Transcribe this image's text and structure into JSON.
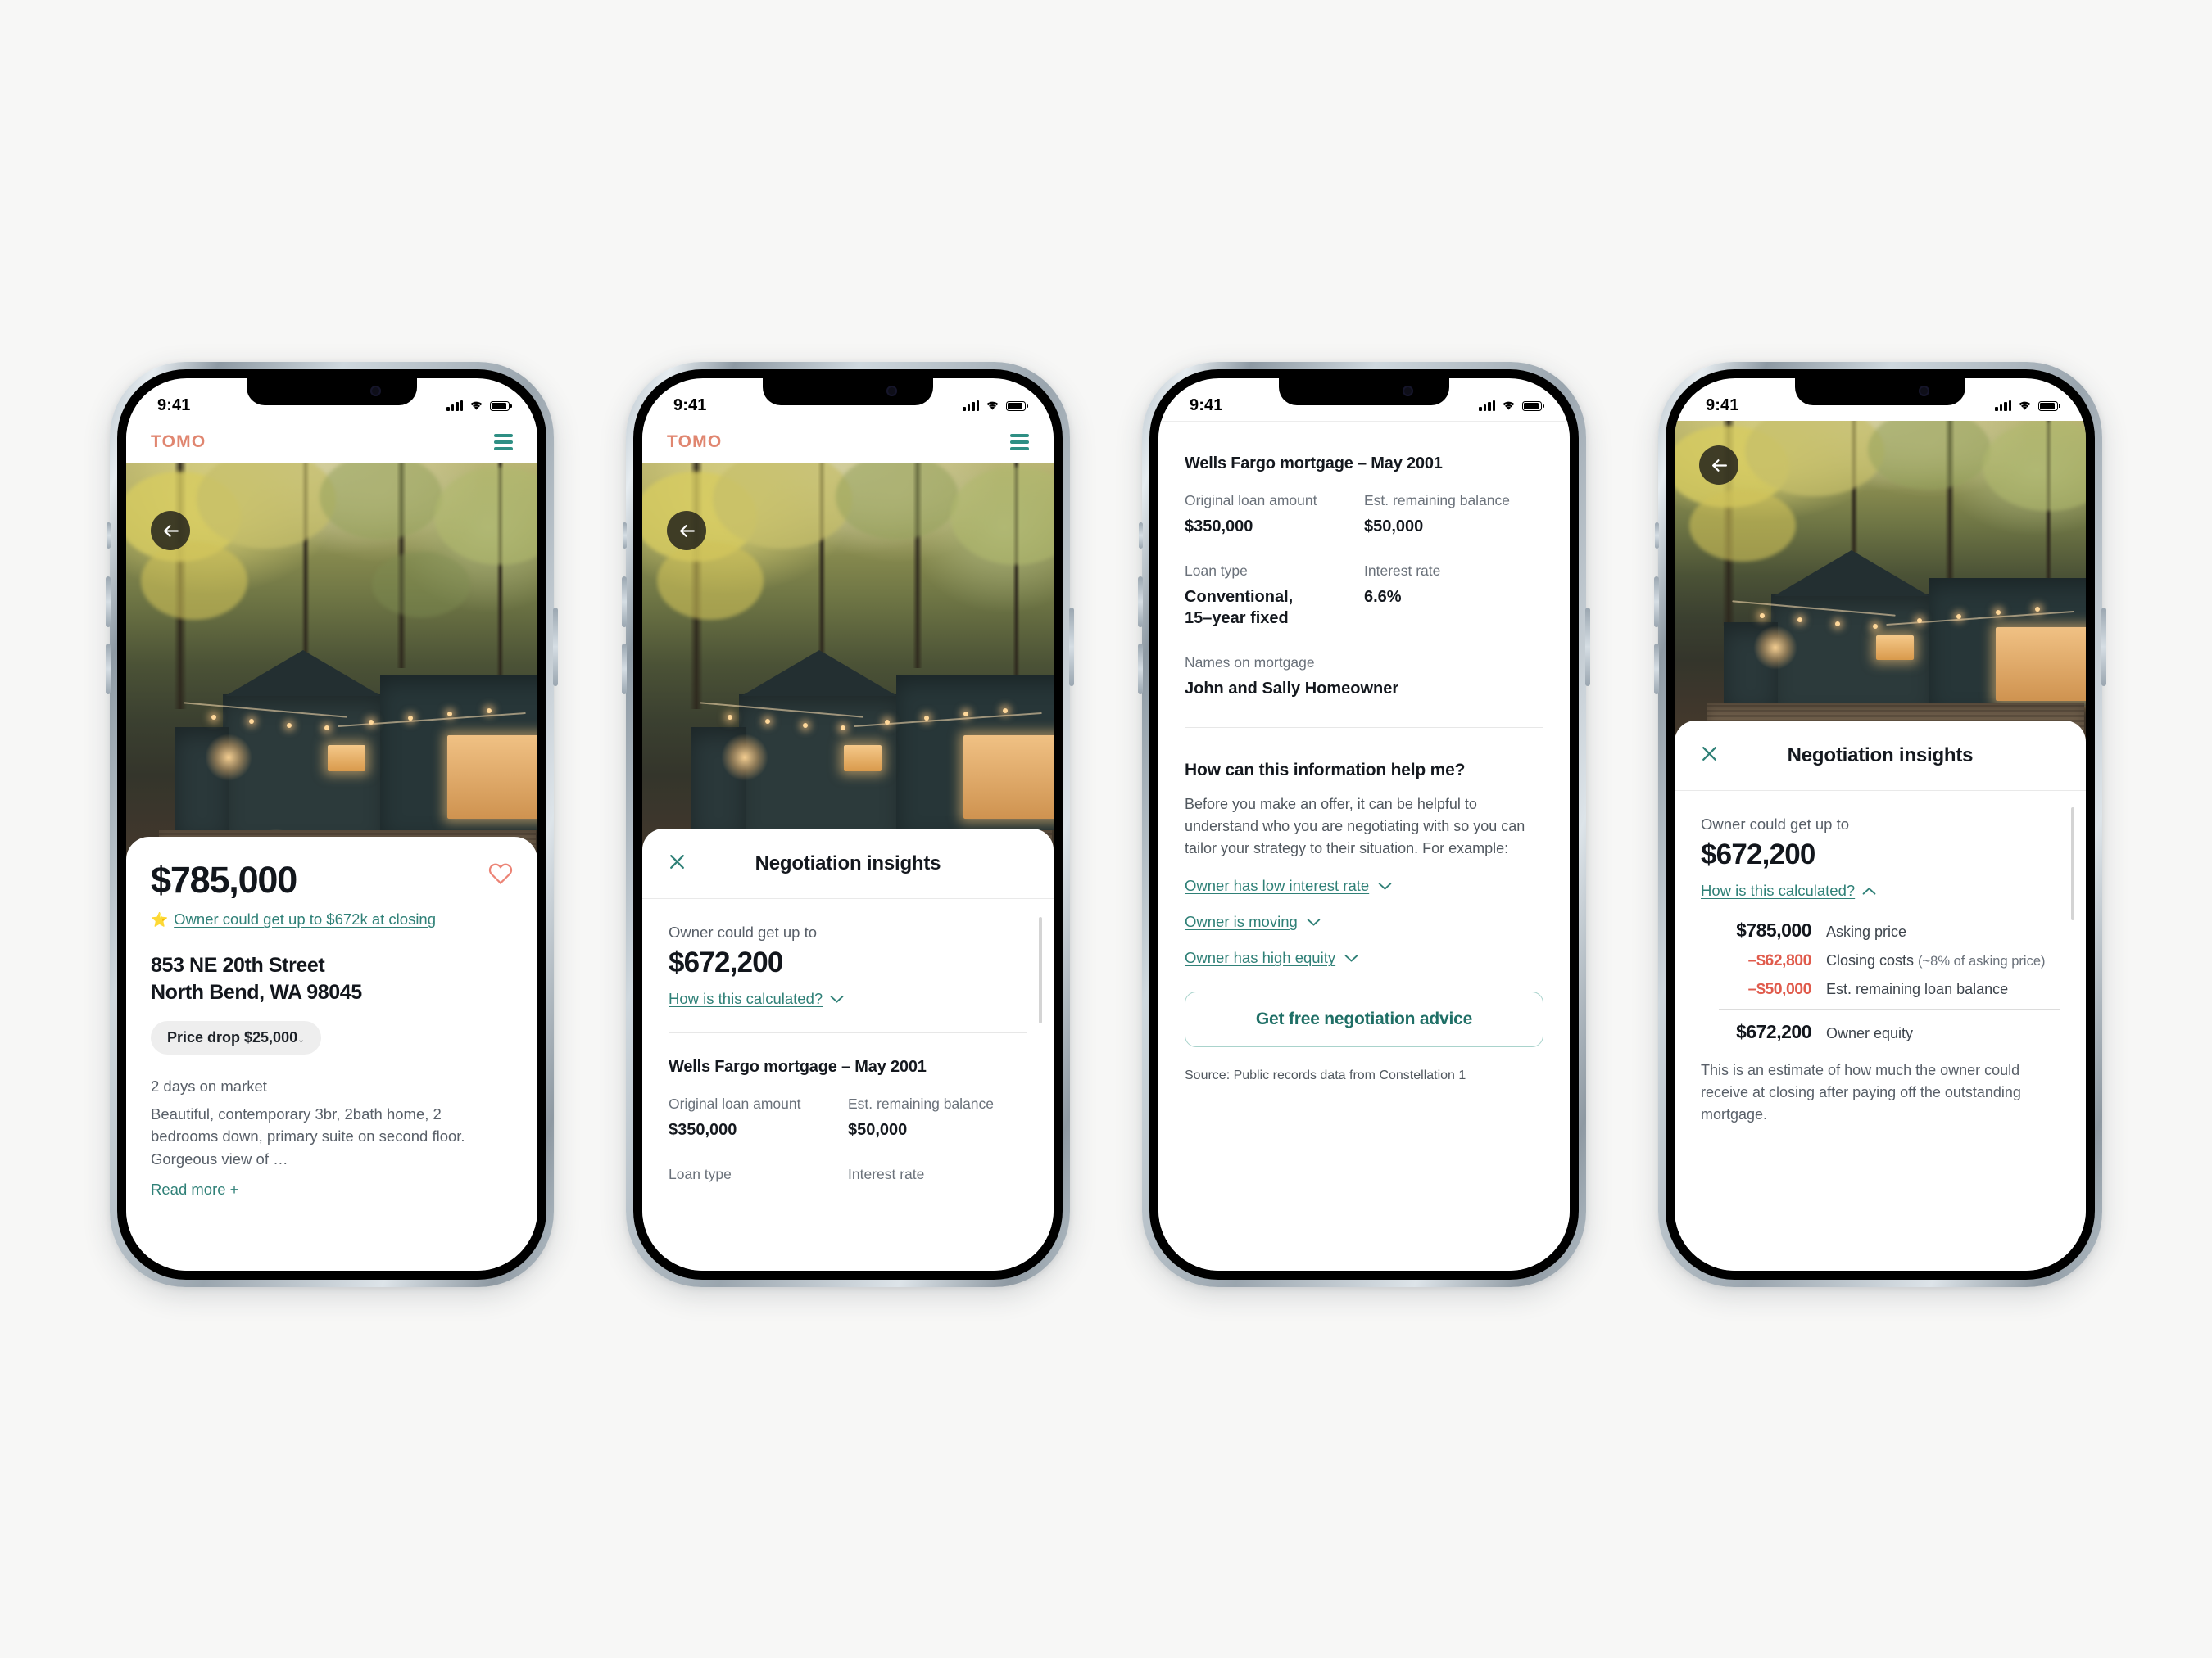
{
  "brand": {
    "name": "TOMO",
    "accent": "#e08670",
    "teal": "#2f8077",
    "red": "#e05b4c",
    "dark": "#12161c"
  },
  "status_bar": {
    "time": "9:41",
    "signal_icon": "cellular-bars-icon",
    "wifi_icon": "wifi-icon",
    "battery_icon": "battery-icon"
  },
  "header": {
    "logo": "TOMO",
    "menu_icon": "hamburger-menu-icon"
  },
  "gallery": {
    "back_icon": "back-arrow-icon",
    "dot_count": 5,
    "active_dot": 0
  },
  "listing": {
    "price": "$785,000",
    "favorite_icon": "heart-icon",
    "star_icon": "⭐",
    "owner_link": "Owner could get up to $672k at closing",
    "address_line1": "853 NE 20th Street",
    "address_line2": "North Bend, WA 98045",
    "price_drop": "Price drop $25,000↓",
    "days_on_market": "2 days on market",
    "description": "Beautiful, contemporary 3br, 2bath home, 2 bedrooms down, primary suite on second floor. Gorgeous view of …",
    "read_more": "Read more +"
  },
  "insights": {
    "close_icon": "close-x-icon",
    "title": "Negotiation insights",
    "kicker": "Owner could get up to",
    "amount": "$672,200",
    "calc_link": "How is this calculated?",
    "chevron_down_icon": "chevron-down-icon",
    "chevron_up_icon": "chevron-up-icon"
  },
  "mortgage": {
    "title": "Wells Fargo mortgage – May 2001",
    "fields": [
      {
        "label": "Original loan amount",
        "value": "$350,000"
      },
      {
        "label": "Est. remaining balance",
        "value": "$50,000"
      },
      {
        "label": "Loan type",
        "value": "Conventional, 15–year fixed"
      },
      {
        "label": "Interest rate",
        "value": "6.6%"
      },
      {
        "label": "Names on mortgage",
        "value": "John and Sally Homeowner"
      }
    ]
  },
  "helper": {
    "heading": "How can this information help me?",
    "body": "Before you make an offer, it can be helpful to understand who you are negotiating with so you can tailor your strategy to their situation. For example:",
    "accordions": [
      "Owner has low interest rate",
      "Owner is moving",
      "Owner has high equity"
    ],
    "cta": "Get free negotiation advice",
    "source_prefix": "Source: Public records data from ",
    "source_link": "Constellation 1"
  },
  "breakdown": {
    "rows": [
      {
        "amount": "$785,000",
        "label": "Asking price",
        "sub": "",
        "negative": false
      },
      {
        "amount": "–$62,800",
        "label": "Closing costs ",
        "sub": "(~8% of asking price)",
        "negative": true
      },
      {
        "amount": "–$50,000",
        "label": "Est. remaining loan balance",
        "sub": "",
        "negative": true
      }
    ],
    "total_amount": "$672,200",
    "total_label": "Owner equity",
    "note": "This is an estimate of how much the owner could receive at closing after paying off the outstanding mortgage."
  }
}
